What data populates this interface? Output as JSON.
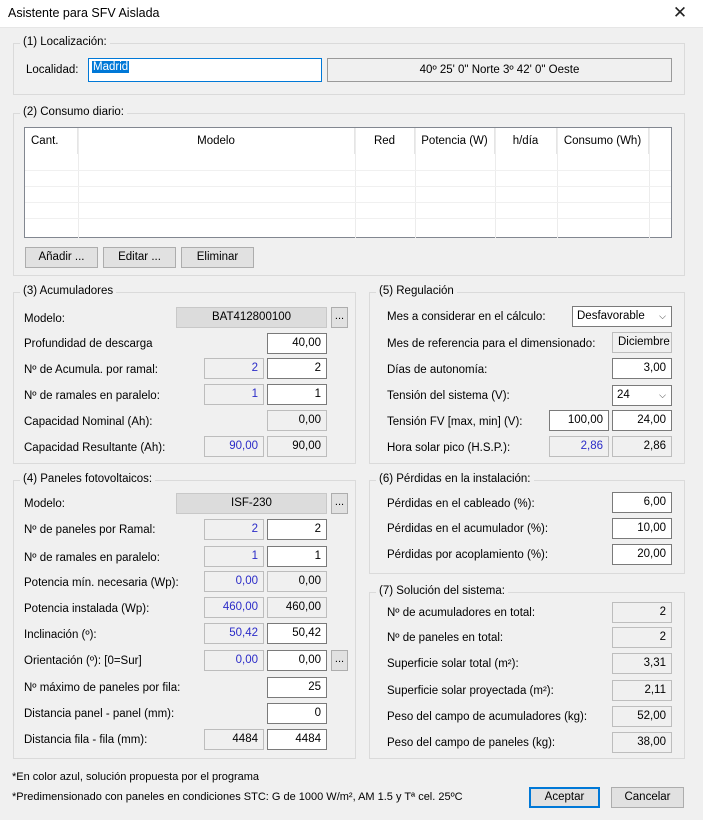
{
  "window": {
    "title": "Asistente para SFV Aislada",
    "close_glyph": "✕"
  },
  "localizacion": {
    "legend": "(1) Localización:",
    "label": "Localidad:",
    "value": "Madrid",
    "coords": "40º 25' 0\" Norte 3º 42' 0\" Oeste"
  },
  "consumo": {
    "legend": "(2) Consumo diario:",
    "columns": [
      "Cant.",
      "Modelo",
      "Red",
      "Potencia (W)",
      "h/día",
      "Consumo (Wh)"
    ],
    "buttons": {
      "add": "Añadir ...",
      "edit": "Editar ...",
      "delete": "Eliminar"
    }
  },
  "acumuladores": {
    "legend": "(3) Acumuladores",
    "modelo_label": "Modelo:",
    "modelo_value": "BAT412800100",
    "dots": "...",
    "profundidad_label": "Profundidad de descarga",
    "profundidad_value": "40,00",
    "acumula_label": "Nº de Acumula. por ramal:",
    "acumula_proposed": "2",
    "acumula_value": "2",
    "ramales_label": "Nº de ramales en paralelo:",
    "ramales_proposed": "1",
    "ramales_value": "1",
    "cap_nominal_label": "Capacidad Nominal (Ah):",
    "cap_nominal_value": "0,00",
    "cap_result_label": "Capacidad Resultante (Ah):",
    "cap_result_proposed": "90,00",
    "cap_result_value": "90,00"
  },
  "paneles": {
    "legend": "(4) Paneles fotovoltaicos:",
    "modelo_label": "Modelo:",
    "modelo_value": "ISF-230",
    "dots": "...",
    "por_ramal_label": "Nº de paneles por Ramal:",
    "por_ramal_proposed": "2",
    "por_ramal_value": "2",
    "ramales_label": "Nº de ramales en paralelo:",
    "ramales_proposed": "1",
    "ramales_value": "1",
    "pot_min_label": "Potencia mín. necesaria (Wp):",
    "pot_min_proposed": "0,00",
    "pot_min_value": "0,00",
    "pot_inst_label": "Potencia instalada (Wp):",
    "pot_inst_proposed": "460,00",
    "pot_inst_value": "460,00",
    "inclinacion_label": "Inclinación (º):",
    "inclinacion_proposed": "50,42",
    "inclinacion_value": "50,42",
    "orientacion_label": "Orientación (º): [0=Sur]",
    "orientacion_proposed": "0,00",
    "orientacion_value": "0,00",
    "max_fila_label": "Nº máximo de paneles por fila:",
    "max_fila_value": "25",
    "dist_panel_label": "Distancia panel - panel (mm):",
    "dist_panel_value": "0",
    "dist_fila_label": "Distancia fila - fila (mm):",
    "dist_fila_proposed": "4484",
    "dist_fila_value": "4484"
  },
  "regulacion": {
    "legend": "(5) Regulación",
    "mes_label": "Mes a considerar en el cálculo:",
    "mes_value": "Desfavorable",
    "mes_ref_label": "Mes de referencia para el dimensionado:",
    "mes_ref_value": "Diciembre",
    "dias_label": "Días de autonomía:",
    "dias_value": "3,00",
    "tension_label": "Tensión del sistema (V):",
    "tension_value": "24",
    "tension_fv_label": "Tensión FV [max, min] (V):",
    "tension_fv_max": "100,00",
    "tension_fv_min": "24,00",
    "hsp_label": "Hora solar pico (H.S.P.):",
    "hsp_proposed": "2,86",
    "hsp_value": "2,86"
  },
  "perdidas": {
    "legend": "(6) Pérdidas en la instalación:",
    "cableado_label": "Pérdidas en el cableado (%):",
    "cableado_value": "6,00",
    "acumulador_label": "Pérdidas en el acumulador (%):",
    "acumulador_value": "10,00",
    "acoplamiento_label": "Pérdidas por acoplamiento (%):",
    "acoplamiento_value": "20,00"
  },
  "solucion": {
    "legend": "(7) Solución del sistema:",
    "acum_total_label": "Nº de acumuladores en total:",
    "acum_total_value": "2",
    "paneles_total_label": "Nº de paneles en total:",
    "paneles_total_value": "2",
    "sup_total_label": "Superficie solar total (m²):",
    "sup_total_value": "3,31",
    "sup_proy_label": "Superficie solar proyectada (m²):",
    "sup_proy_value": "2,11",
    "peso_acum_label": "Peso del campo de acumuladores (kg):",
    "peso_acum_value": "52,00",
    "peso_pan_label": "Peso del campo de paneles (kg):",
    "peso_pan_value": "38,00"
  },
  "footer": {
    "note1": "*En color azul, solución propuesta por el programa",
    "note2": "*Predimensionado con paneles en condiciones STC: G de 1000 W/m², AM 1.5 y Tª cel. 25ºC",
    "accept": "Aceptar",
    "cancel": "Cancelar"
  },
  "colors": {
    "proposed_text": "#2b2bc8",
    "focus": "#0078d7"
  }
}
